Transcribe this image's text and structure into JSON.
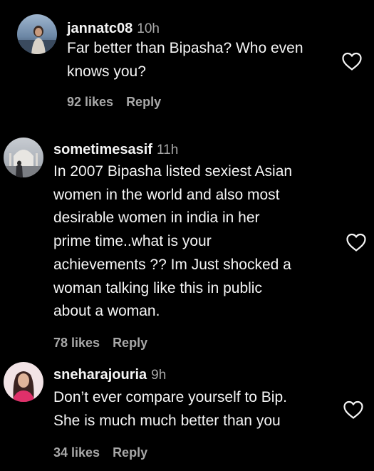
{
  "icons": {
    "like": "heart-outline-icon"
  },
  "colors": {
    "background": "#000000",
    "primary_text": "#f5f5f5",
    "secondary_text": "#a8a8a8"
  },
  "comments": [
    {
      "username": "jannatc08",
      "time": "10h",
      "text": "Far better than Bipasha? Who even\nknows you?",
      "likes": "92 likes",
      "reply": "Reply"
    },
    {
      "username": "sometimesasif",
      "time": "11h",
      "text": "In 2007 Bipasha listed sexiest Asian\nwomen in the world and also most\ndesirable women in india in her\nprime time..what is your\nachievements ?? Im Just shocked a\nwoman talking like this in public\nabout a woman.",
      "likes": "78 likes",
      "reply": "Reply"
    },
    {
      "username": "sneharajouria",
      "time": "9h",
      "text": "Don’t ever compare yourself to Bip.\nShe is much much better than you",
      "likes": "34 likes",
      "reply": "Reply"
    }
  ]
}
